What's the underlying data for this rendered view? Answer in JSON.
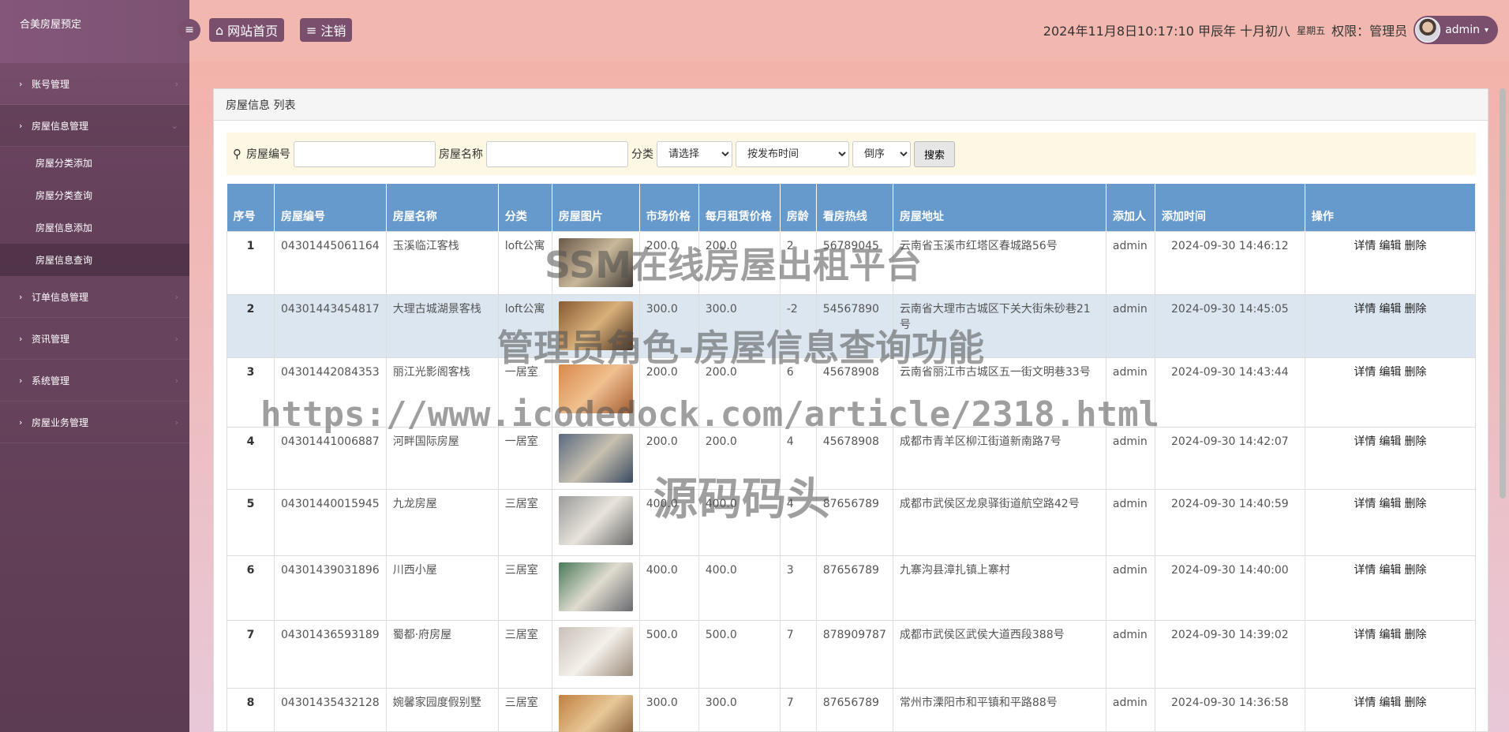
{
  "app": {
    "title": "合美房屋预定"
  },
  "sidebar": {
    "items": [
      {
        "label": "账号管理"
      },
      {
        "label": "房屋信息管理"
      },
      {
        "label": "订单信息管理"
      },
      {
        "label": "资讯管理"
      },
      {
        "label": "系统管理"
      },
      {
        "label": "房屋业务管理"
      }
    ],
    "sub": [
      {
        "label": "房屋分类添加"
      },
      {
        "label": "房屋分类查询"
      },
      {
        "label": "房屋信息添加"
      },
      {
        "label": "房屋信息查询"
      }
    ]
  },
  "topbar": {
    "home": "网站首页",
    "logout": "注销",
    "datetime": "2024年11月8日10:17:10 甲辰年 十月初八",
    "weekday": "星期五",
    "role": "权限：管理员",
    "user": "admin"
  },
  "panel": {
    "title": "房屋信息 列表"
  },
  "search": {
    "label_no": "房屋编号",
    "label_name": "房屋名称",
    "label_cat": "分类",
    "cat_selected": "请选择",
    "sort_selected": "按发布时间",
    "order_selected": "倒序",
    "button": "搜索"
  },
  "table": {
    "headers": [
      "序号",
      "房屋编号",
      "房屋名称",
      "分类",
      "房屋图片",
      "市场价格",
      "每月租赁价格",
      "房龄",
      "看房热线",
      "房屋地址",
      "添加人",
      "添加时间",
      "操作"
    ],
    "actions": [
      "详情",
      "编辑",
      "删除"
    ],
    "rows": [
      {
        "idx": "1",
        "no": "04301445061164",
        "name": "玉溪临江客栈",
        "cat": "loft公寓",
        "price": "200.0",
        "rent": "200.0",
        "age": "2",
        "hotline": "56789045",
        "addr": "云南省玉溪市红塔区春城路56号",
        "by": "admin",
        "time": "2024-09-30 14:46:12"
      },
      {
        "idx": "2",
        "no": "04301443454817",
        "name": "大理古城湖景客栈",
        "cat": "loft公寓",
        "price": "300.0",
        "rent": "300.0",
        "age": "-2",
        "hotline": "54567890",
        "addr": "云南省大理市古城区下关大街朱砂巷21号",
        "by": "admin",
        "time": "2024-09-30 14:45:05"
      },
      {
        "idx": "3",
        "no": "04301442084353",
        "name": "丽江光影阁客栈",
        "cat": "一居室",
        "price": "200.0",
        "rent": "200.0",
        "age": "6",
        "hotline": "45678908",
        "addr": "云南省丽江市古城区五一街文明巷33号",
        "by": "admin",
        "time": "2024-09-30 14:43:44"
      },
      {
        "idx": "4",
        "no": "04301441006887",
        "name": "河畔国际房屋",
        "cat": "一居室",
        "price": "200.0",
        "rent": "200.0",
        "age": "4",
        "hotline": "45678908",
        "addr": "成都市青羊区柳江街道新南路7号",
        "by": "admin",
        "time": "2024-09-30 14:42:07"
      },
      {
        "idx": "5",
        "no": "04301440015945",
        "name": "九龙房屋",
        "cat": "三居室",
        "price": "400.0",
        "rent": "400.0",
        "age": "4",
        "hotline": "87656789",
        "addr": "成都市武侯区龙泉驿街道航空路42号",
        "by": "admin",
        "time": "2024-09-30 14:40:59"
      },
      {
        "idx": "6",
        "no": "04301439031896",
        "name": "川西小屋",
        "cat": "三居室",
        "price": "400.0",
        "rent": "400.0",
        "age": "3",
        "hotline": "87656789",
        "addr": "九寨沟县漳扎镇上寨村",
        "by": "admin",
        "time": "2024-09-30 14:40:00"
      },
      {
        "idx": "7",
        "no": "04301436593189",
        "name": "蜀都·府房屋",
        "cat": "三居室",
        "price": "500.0",
        "rent": "500.0",
        "age": "7",
        "hotline": "878909787",
        "addr": "成都市武侯区武侯大道西段388号",
        "by": "admin",
        "time": "2024-09-30 14:39:02"
      },
      {
        "idx": "8",
        "no": "04301435432128",
        "name": "婉馨家园度假别墅",
        "cat": "三居室",
        "price": "300.0",
        "rent": "300.0",
        "age": "7",
        "hotline": "87656789",
        "addr": "常州市溧阳市和平镇和平路88号",
        "by": "admin",
        "time": "2024-09-30 14:36:58"
      }
    ]
  },
  "watermark": {
    "line1": "SSM在线房屋出租平台",
    "line2": "管理员角色-房屋信息查询功能",
    "line3": "https://www.icodedock.com/article/2318.html",
    "line4": "源码码头"
  },
  "colors": {
    "sidebar": "#6b4560",
    "header_row": "#6699cc",
    "topbar": "#f2b8b0"
  }
}
